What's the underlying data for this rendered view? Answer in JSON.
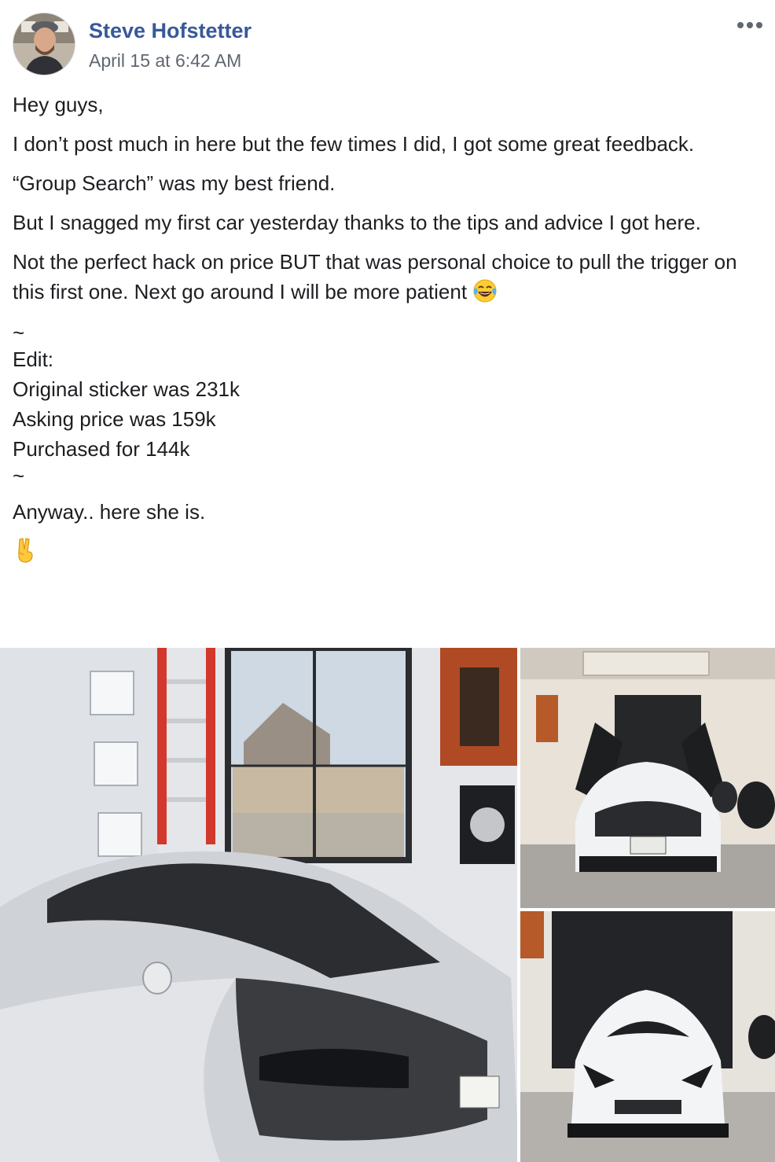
{
  "post": {
    "author": "Steve Hofstetter",
    "timestamp": "April 15 at 6:42 AM",
    "menu_icon": "more-horizontal-icon",
    "body": {
      "greeting": "Hey guys,",
      "line2": "I don’t post much in here but the few times I did, I got some great feedback.",
      "line3": "“Group Search” was my best friend.",
      "line4": "But I snagged my first car yesterday thanks to the tips and advice I got here.",
      "line5": "Not the perfect hack on price BUT that was personal choice to pull the trigger on this first one. Next go around I will be more patient",
      "line5_emoji": "laughing-tears-emoji",
      "separator": "~",
      "edit_label": "Edit:",
      "sticker": "Original sticker was 231k",
      "asking": "Asking price was 159k",
      "purchased": "Purchased for 144k",
      "closing": "Anyway.. here she is.",
      "closing_emoji": "victory-hand-emoji"
    },
    "photos": [
      {
        "name": "photo-car-side-garage"
      },
      {
        "name": "photo-car-rear-doors-up"
      },
      {
        "name": "photo-car-front-garage"
      }
    ]
  }
}
